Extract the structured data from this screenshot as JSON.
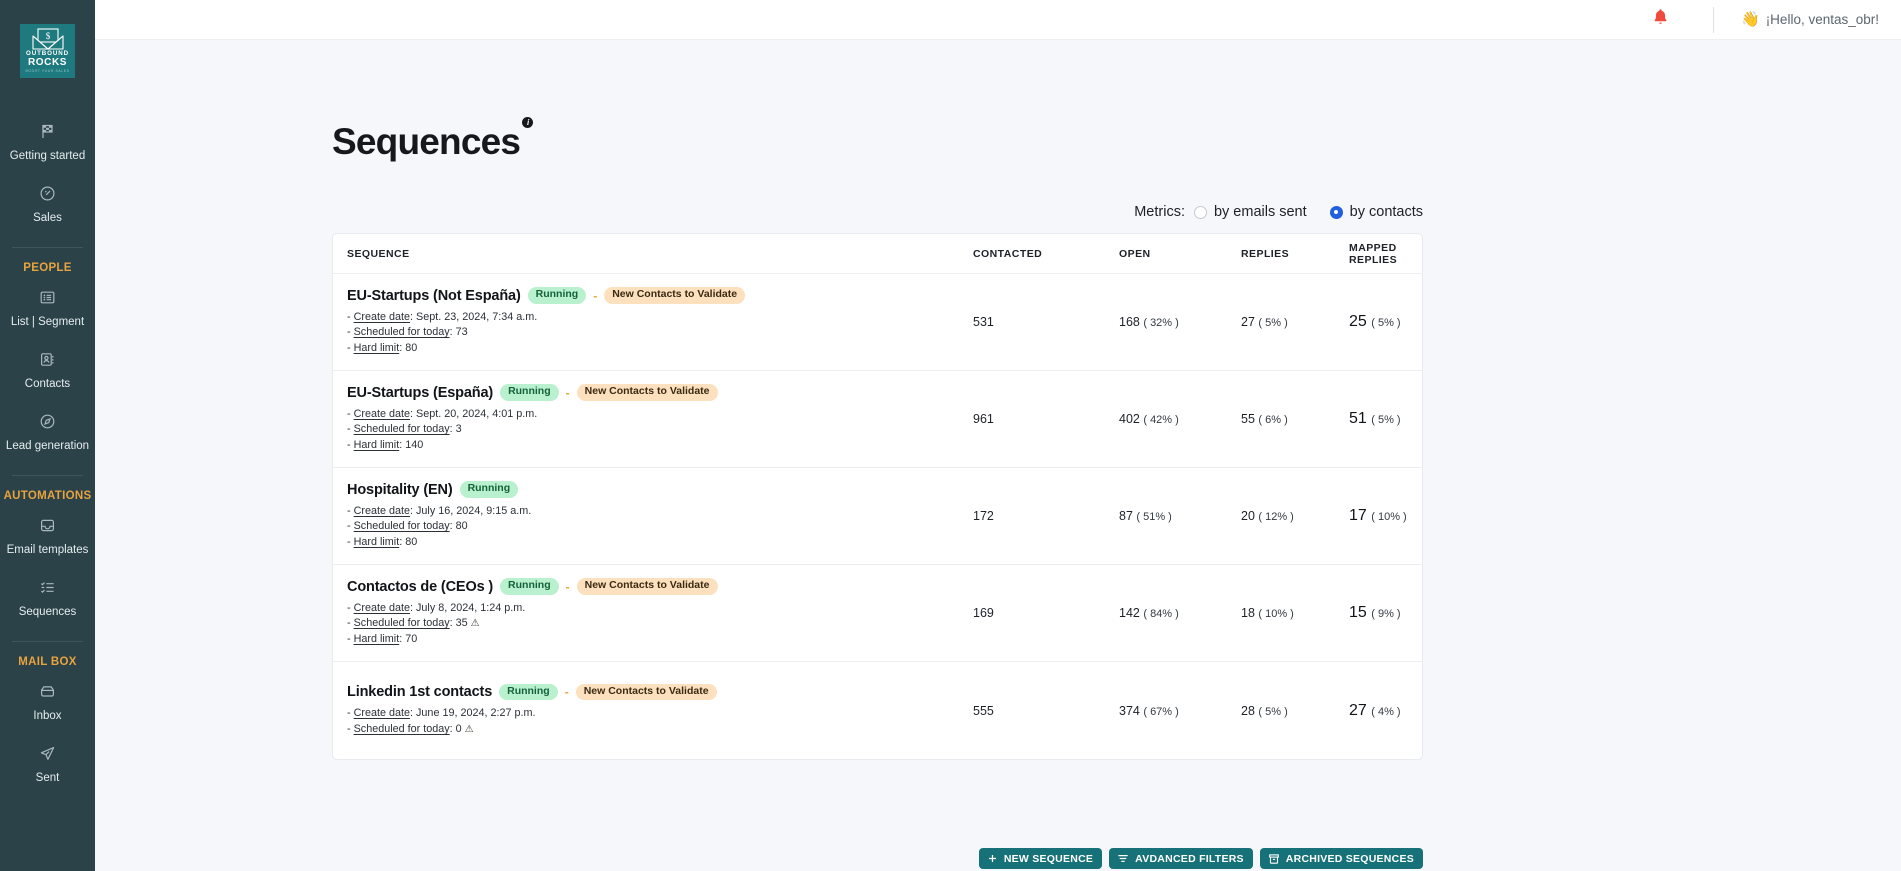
{
  "sidebar": {
    "logo": {
      "line1": "OUTBOUND",
      "line2": "ROCKS",
      "line3": "BOOST YOUR SALES",
      "icon": "envelope-dollar-logo"
    },
    "items": [
      {
        "label": "Getting started",
        "icon": "flag-checkered-icon",
        "type": "item"
      },
      {
        "label": "Sales",
        "icon": "speedometer-icon",
        "type": "item"
      },
      {
        "label": "PEOPLE",
        "type": "group"
      },
      {
        "label": "List | Segment",
        "icon": "list-icon",
        "type": "item"
      },
      {
        "label": "Contacts",
        "icon": "contact-card-icon",
        "type": "item"
      },
      {
        "label": "Lead generation",
        "icon": "compass-icon",
        "type": "item"
      },
      {
        "label": "AUTOMATIONS",
        "type": "group"
      },
      {
        "label": "Email templates",
        "icon": "inbox-tray-icon",
        "type": "item"
      },
      {
        "label": "Sequences",
        "icon": "checklist-icon",
        "type": "item"
      },
      {
        "label": "MAIL BOX",
        "type": "group"
      },
      {
        "label": "Inbox",
        "icon": "inbox-icon",
        "type": "item"
      },
      {
        "label": "Sent",
        "icon": "paper-plane-icon",
        "type": "item"
      }
    ]
  },
  "topbar": {
    "bell_icon": "notification-bell-icon",
    "wave_icon": "waving-hand-icon",
    "greeting": "¡Hello, ventas_obr!"
  },
  "page": {
    "title": "Sequences",
    "info_badge": "i"
  },
  "actions": {
    "new_sequence": "NEW SEQUENCE",
    "advanced_filters": "AVDANCED FILTERS",
    "archived_sequences": "ARCHIVED SEQUENCES"
  },
  "metrics": {
    "label": "Metrics:",
    "options": [
      {
        "label": "by emails sent",
        "selected": false
      },
      {
        "label": "by contacts",
        "selected": true
      }
    ]
  },
  "table": {
    "columns": [
      "SEQUENCE",
      "CONTACTED",
      "OPEN",
      "REPLIES",
      "MAPPED REPLIES"
    ],
    "rows": [
      {
        "name": "EU-Startups (Not España)",
        "status": "Running",
        "separator": "-",
        "tag": "New Contacts to Validate",
        "create_label": "Create date",
        "create_value": ": Sept. 23, 2024, 7:34 a.m.",
        "scheduled_label": "Scheduled for today",
        "scheduled_value": ": 73",
        "scheduled_warning": false,
        "limit_label": "Hard limit",
        "limit_value": ": 80",
        "contacted": "531",
        "open": "168",
        "open_pct": "( 32% )",
        "replies": "27",
        "replies_pct": "( 5% )",
        "mapped": "25",
        "mapped_pct": "( 5% )"
      },
      {
        "name": "EU-Startups (España)",
        "status": "Running",
        "separator": "-",
        "tag": "New Contacts to Validate",
        "create_label": "Create date",
        "create_value": ": Sept. 20, 2024, 4:01 p.m.",
        "scheduled_label": "Scheduled for today",
        "scheduled_value": ": 3",
        "scheduled_warning": false,
        "limit_label": "Hard limit",
        "limit_value": ": 140",
        "contacted": "961",
        "open": "402",
        "open_pct": "( 42% )",
        "replies": "55",
        "replies_pct": "( 6% )",
        "mapped": "51",
        "mapped_pct": "( 5% )"
      },
      {
        "name": "Hospitality (EN)",
        "status": "Running",
        "separator": "",
        "tag": "",
        "create_label": "Create date",
        "create_value": ": July 16, 2024, 9:15 a.m.",
        "scheduled_label": "Scheduled for today",
        "scheduled_value": ": 80",
        "scheduled_warning": false,
        "limit_label": "Hard limit",
        "limit_value": ": 80",
        "contacted": "172",
        "open": "87",
        "open_pct": "( 51% )",
        "replies": "20",
        "replies_pct": "( 12% )",
        "mapped": "17",
        "mapped_pct": "( 10% )"
      },
      {
        "name": "Contactos de (CEOs )",
        "status": "Running",
        "separator": "-",
        "tag": "New Contacts to Validate",
        "create_label": "Create date",
        "create_value": ": July 8, 2024, 1:24 p.m.",
        "scheduled_label": "Scheduled for today",
        "scheduled_value": ": 35",
        "scheduled_warning": true,
        "limit_label": "Hard limit",
        "limit_value": ": 70",
        "contacted": "169",
        "open": "142",
        "open_pct": "( 84% )",
        "replies": "18",
        "replies_pct": "( 10% )",
        "mapped": "15",
        "mapped_pct": "( 9% )"
      },
      {
        "name": "Linkedin 1st contacts",
        "status": "Running",
        "separator": "-",
        "tag": "New Contacts to Validate",
        "create_label": "Create date",
        "create_value": ": June 19, 2024, 2:27 p.m.",
        "scheduled_label": "Scheduled for today",
        "scheduled_value": ": 0",
        "scheduled_warning": true,
        "limit_label": "",
        "limit_value": "",
        "contacted": "555",
        "open": "374",
        "open_pct": "( 67% )",
        "replies": "28",
        "replies_pct": "( 5% )",
        "mapped": "27",
        "mapped_pct": "( 4% )"
      }
    ]
  },
  "colors": {
    "sidebar_bg": "#2b4249",
    "brand_teal": "#167178",
    "group_orange": "#e8a33d",
    "radio_blue": "#1f5fe0",
    "pill_running_bg": "#b9f0cd",
    "pill_validate_bg": "#fde0bd"
  }
}
